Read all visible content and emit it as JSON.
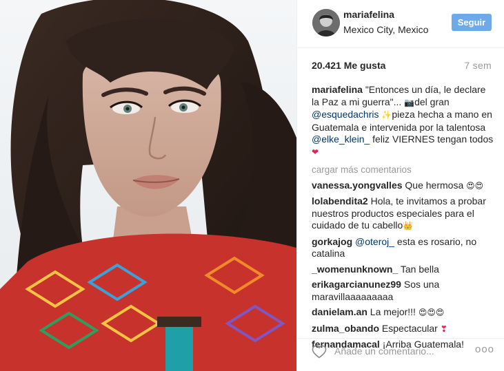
{
  "post": {
    "username": "mariafelina",
    "location": "Mexico City, Mexico",
    "follow_label": "Seguir",
    "likes": "20.421 Me gusta",
    "age": "7 sem",
    "caption": {
      "username": "mariafelina",
      "text1": " \"Entonces un día, le declare la Paz a mi guerra\"... ",
      "text2": "del gran ",
      "mention1": "@esquedachris",
      "text3": "pieza hecha a mano en Guatemala e intervenida por la talentosa ",
      "mention2": "@elke_klein_",
      "text4": " feliz VIERNES tengan todos"
    },
    "load_more": "cargar más comentarios",
    "comments": [
      {
        "username": "vanessa.yongvalles",
        "text": " Que hermosa ",
        "emoji": "😍😍"
      },
      {
        "username": "lolabendita2",
        "text": " Hola, te invitamos a probar nuestros productos especiales para el cuidado de tu cabello",
        "emoji": "👑"
      },
      {
        "username": "gorkajog",
        "mention": "@oteroj_",
        "text": " esta es rosario, no catalina",
        "emoji": ""
      },
      {
        "username": "_womenunknown_",
        "text": " Tan bella",
        "emoji": ""
      },
      {
        "username": "erikagarcianunez99",
        "text": " Sos una maravillaaaaaaaaa",
        "emoji": ""
      },
      {
        "username": "danielam.an",
        "text": " La mejor!!! ",
        "emoji": "😍😍😍"
      },
      {
        "username": "zulma_obando",
        "text": " Espectacular ",
        "emoji": "❣"
      },
      {
        "username": "fernandamacal",
        "text": " ¡Arriba Guatemala!",
        "emoji": ""
      }
    ],
    "add_comment_placeholder": "Añade un comentario...",
    "more_label": "ooo"
  },
  "icons": {
    "heart": "heart-outline-icon",
    "camera": "camera-emoji",
    "sparkle": "sparkles-emoji",
    "red_heart": "red-heart-emoji"
  },
  "colors": {
    "follow_button": "#70a9e8",
    "mention": "#003569",
    "muted": "#999999"
  }
}
